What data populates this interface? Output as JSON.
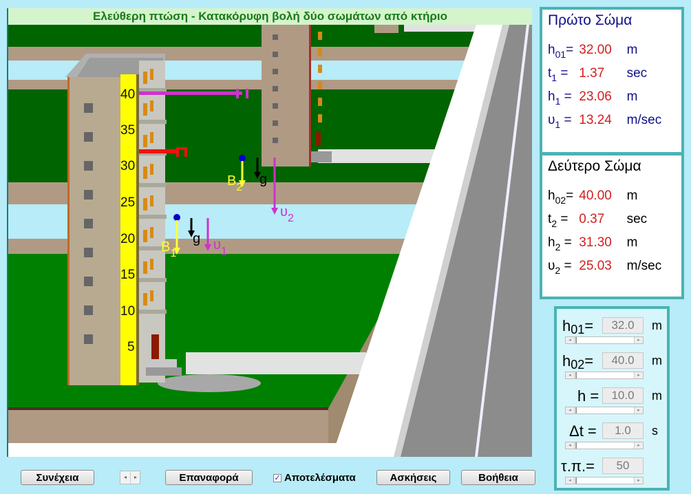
{
  "scene": {
    "title": "Ελεύθερη πτώση - Κατακόρυφη βολή δύο σωμάτων από κτήριο",
    "scale_labels": [
      "40",
      "35",
      "30",
      "25",
      "20",
      "15",
      "10",
      "5"
    ],
    "body1": {
      "label": "B",
      "index": "1",
      "velocity_label": "υ",
      "velocity_index": "1",
      "gravity_label": "g"
    },
    "body2": {
      "label": "B",
      "index": "2",
      "velocity_label": "υ",
      "velocity_index": "2",
      "gravity_label": "g"
    },
    "colors": {
      "grass": "#008000",
      "dark_grass": "#006400",
      "soil": "#b09a84",
      "road": "#8c8c8c",
      "scale": "#ffff00",
      "body1_marker": "#dd2020",
      "body2_marker": "#cc33cc",
      "ball": "#0000cc"
    }
  },
  "body1_panel": {
    "heading": "Πρώτο Σώμα",
    "rows": [
      {
        "sym": "h",
        "sub": "01",
        "eq": "=",
        "value": "32.00",
        "unit": "m"
      },
      {
        "sym": "t",
        "sub": "1",
        "eq": " =",
        "value": "1.37",
        "unit": "sec"
      },
      {
        "sym": "h",
        "sub": "1",
        "eq": " =",
        "value": "23.06",
        "unit": "m"
      },
      {
        "sym": "υ",
        "sub": "1",
        "eq": " =",
        "value": "13.24",
        "unit": "m/sec"
      }
    ]
  },
  "body2_panel": {
    "heading": "Δεύτερο Σώμα",
    "rows": [
      {
        "sym": "h",
        "sub": "02",
        "eq": "=",
        "value": "40.00",
        "unit": "m"
      },
      {
        "sym": "t",
        "sub": "2",
        "eq": " =",
        "value": "0.37",
        "unit": "sec"
      },
      {
        "sym": "h",
        "sub": "2",
        "eq": " =",
        "value": "31.30",
        "unit": "m"
      },
      {
        "sym": "υ",
        "sub": "2",
        "eq": " =",
        "value": "25.03",
        "unit": "m/sec"
      }
    ]
  },
  "controls": [
    {
      "name": "h",
      "sub": "01",
      "eq": "=",
      "value": "32.0",
      "unit": "m"
    },
    {
      "name": "h",
      "sub": "02",
      "eq": "=",
      "value": "40.0",
      "unit": "m"
    },
    {
      "name": "h",
      "sub": "",
      "eq": " =",
      "value": "10.0",
      "unit": "m"
    },
    {
      "name": "Δt",
      "sub": "",
      "eq": " =",
      "value": "1.0",
      "unit": "s"
    },
    {
      "name": "τ.π.",
      "sub": "",
      "eq": "=",
      "value": "50",
      "unit": ""
    }
  ],
  "buttons": {
    "continue": "Συνέχεια",
    "reset": "Επαναφορά",
    "results_checkbox": "Αποτελέσματα",
    "results_checked": true,
    "exercises": "Ασκήσεις",
    "help": "Βοήθεια"
  }
}
